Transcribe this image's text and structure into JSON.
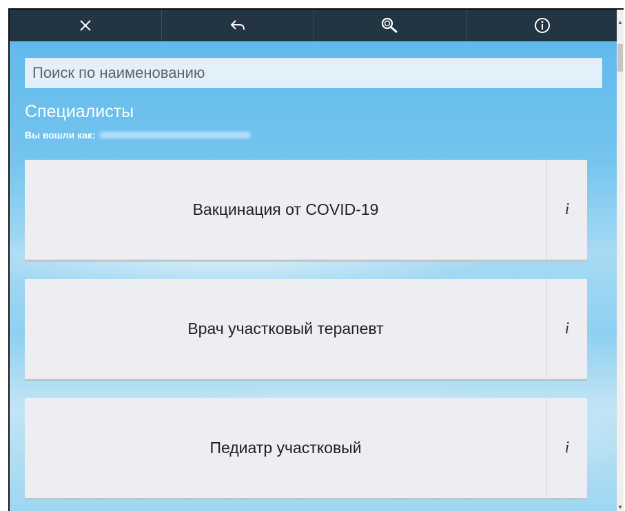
{
  "toolbar": {
    "buttons": [
      {
        "icon": "close-icon"
      },
      {
        "icon": "back-arrow-icon"
      },
      {
        "icon": "search-icon"
      },
      {
        "icon": "info-circle-icon"
      }
    ],
    "background": "#233443"
  },
  "search": {
    "placeholder": "Поиск по наименованию",
    "value": ""
  },
  "page": {
    "title": "Специалисты",
    "logged_in_label": "Вы вошли как:"
  },
  "specialists": [
    {
      "label": "Вакцинация от COVID-19",
      "info": "i"
    },
    {
      "label": "Врач участковый терапевт",
      "info": "i"
    },
    {
      "label": "Педиатр участковый",
      "info": "i"
    }
  ],
  "colors": {
    "card_bg": "#eceef1",
    "sky": "#74c4ee"
  }
}
